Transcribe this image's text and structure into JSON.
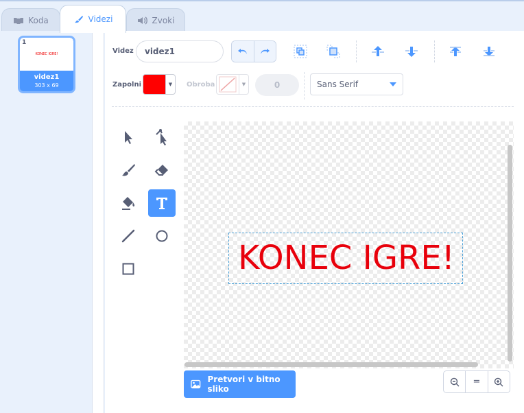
{
  "tabs": [
    {
      "label": "Koda",
      "icon": "code-icon"
    },
    {
      "label": "Videzi",
      "icon": "brush-icon"
    },
    {
      "label": "Zvoki",
      "icon": "speaker-icon"
    }
  ],
  "costume": {
    "number": "1",
    "thumb_text": "KONEC IGRE!",
    "name": "videz1",
    "size": "303 x 69"
  },
  "editor": {
    "name_label": "Videz",
    "name_value": "videz1",
    "fill_label": "Zapolni",
    "fill_color": "#ff0000",
    "outline_label": "Obroba",
    "outline_width": "0",
    "font": "Sans Serif"
  },
  "canvas": {
    "text": "KONEC IGRE!",
    "text_color": "#e8000b"
  },
  "bitmap_button": "Pretvori v bitno sliko",
  "zoom": {
    "reset": "="
  },
  "colors": {
    "accent": "#4c97ff",
    "selection": "#4aa0d8"
  }
}
